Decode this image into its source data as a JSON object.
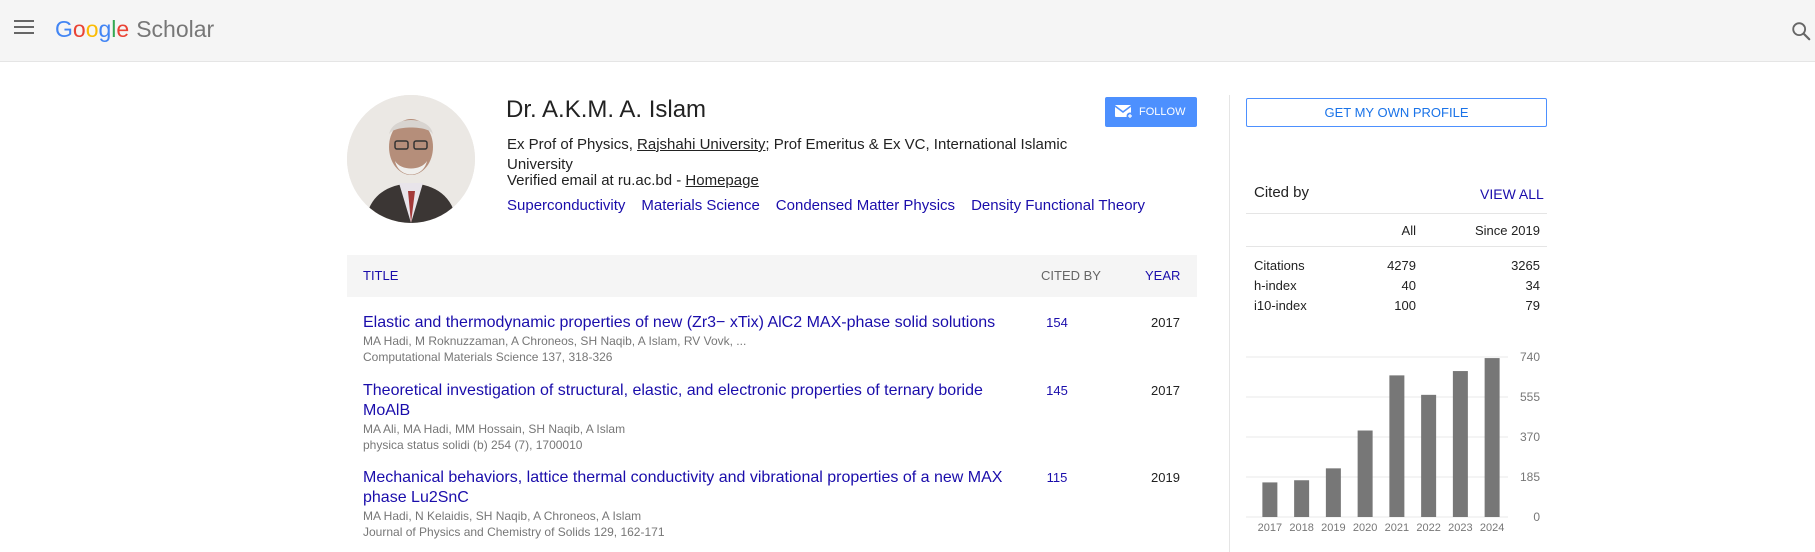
{
  "header": {
    "logo_letters": [
      "G",
      "o",
      "o",
      "g",
      "l",
      "e"
    ],
    "logo_product": "Scholar"
  },
  "profile": {
    "name": "Dr. A.K.M. A. Islam",
    "affiliation_prefix": "Ex Prof of Physics, ",
    "affiliation_link": "Rajshahi University;",
    "affiliation_suffix": " Prof Emeritus & Ex VC, International Islamic University",
    "email_text": "Verified email at ru.ac.bd - ",
    "homepage_label": "Homepage",
    "interests": [
      "Superconductivity",
      "Materials Science",
      "Condensed Matter Physics",
      "Density Functional Theory"
    ],
    "follow_label": "FOLLOW"
  },
  "table": {
    "headers": {
      "title": "TITLE",
      "cited_by": "CITED BY",
      "year": "YEAR"
    },
    "rows": [
      {
        "title": "Elastic and thermodynamic properties of new (Zr3− xTix) AlC2 MAX-phase solid solutions",
        "authors": "MA Hadi, M Roknuzzaman, A Chroneos, SH Naqib, A Islam, RV Vovk, ...",
        "venue": "Computational Materials Science 137, 318-326",
        "cited": "154",
        "year": "2017"
      },
      {
        "title": "Theoretical investigation of structural, elastic, and electronic properties of ternary boride MoAlB",
        "authors": "MA Ali, MA Hadi, MM Hossain, SH Naqib, A Islam",
        "venue": "physica status solidi (b) 254 (7), 1700010",
        "cited": "145",
        "year": "2017"
      },
      {
        "title": "Mechanical behaviors, lattice thermal conductivity and vibrational properties of a new MAX phase Lu2SnC",
        "authors": "MA Hadi, N Kelaidis, SH Naqib, A Chroneos, A Islam",
        "venue": "Journal of Physics and Chemistry of Solids 129, 162-171",
        "cited": "115",
        "year": "2019"
      }
    ]
  },
  "sidebar": {
    "own_profile_label": "GET MY OWN PROFILE",
    "cited_by_label": "Cited by",
    "view_all_label": "VIEW ALL",
    "col_all": "All",
    "col_since": "Since 2019",
    "stats": [
      {
        "label": "Citations",
        "all": "4279",
        "since": "3265"
      },
      {
        "label": "h-index",
        "all": "40",
        "since": "34"
      },
      {
        "label": "i10-index",
        "all": "100",
        "since": "79"
      }
    ]
  },
  "chart_data": {
    "type": "bar",
    "categories": [
      "2017",
      "2018",
      "2019",
      "2020",
      "2021",
      "2022",
      "2023",
      "2024"
    ],
    "values": [
      160,
      170,
      225,
      400,
      655,
      565,
      675,
      735
    ],
    "yticks": [
      "740",
      "555",
      "370",
      "185",
      "0"
    ],
    "ylim": [
      0,
      740
    ],
    "bar_color": "#777777",
    "grid": true
  }
}
